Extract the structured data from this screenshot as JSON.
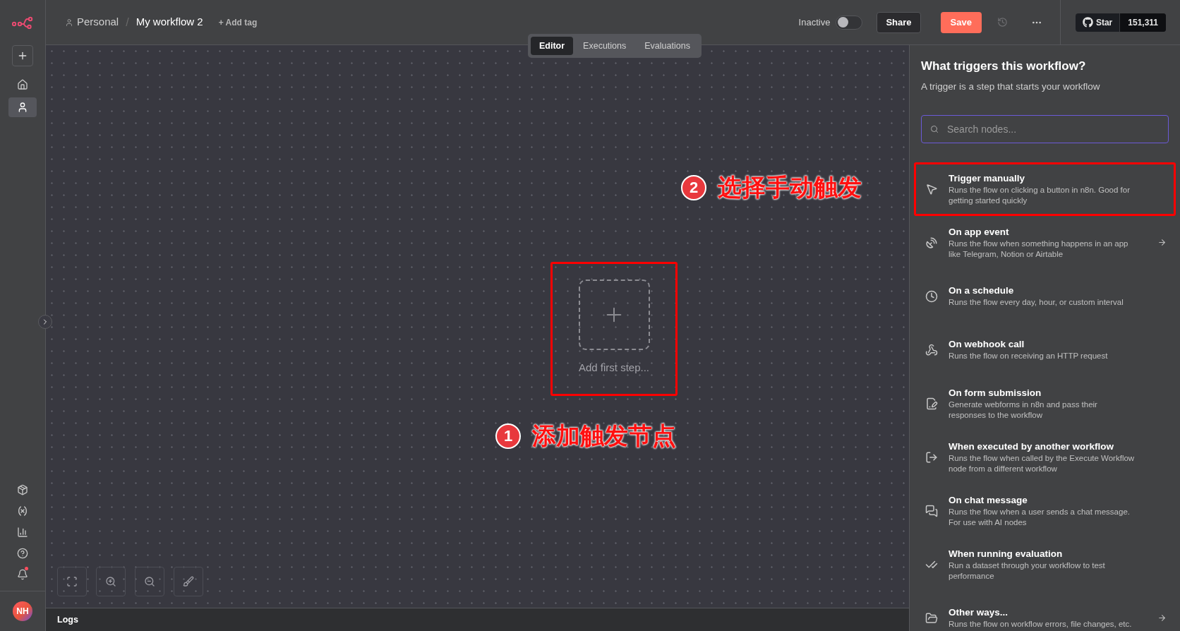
{
  "breadcrumb": {
    "project": "Personal",
    "separator": "/",
    "workflow": "My workflow 2",
    "add_tag": "+ Add tag"
  },
  "tabs": [
    {
      "label": "Editor",
      "selected": true
    },
    {
      "label": "Executions",
      "selected": false
    },
    {
      "label": "Evaluations",
      "selected": false
    }
  ],
  "header": {
    "status_label": "Inactive",
    "active": false,
    "share": "Share",
    "save": "Save",
    "github": {
      "label": "Star",
      "count": "151,311"
    }
  },
  "sidebar": {
    "items": [
      {
        "kind": "home",
        "selected": false
      },
      {
        "kind": "person",
        "selected": true
      }
    ],
    "bottom": [
      {
        "kind": "templates",
        "badge": false
      },
      {
        "kind": "variables",
        "badge": false
      },
      {
        "kind": "insights",
        "badge": false
      },
      {
        "kind": "help",
        "badge": false
      },
      {
        "kind": "notifications",
        "badge": true
      }
    ],
    "avatar": "NH"
  },
  "canvas": {
    "add_step": {
      "label": "Add first step...",
      "annotated": true
    },
    "annotations": [
      {
        "number": "1",
        "text": "添加触发节点"
      },
      {
        "number": "2",
        "text": "选择手动触发"
      }
    ],
    "logs": "Logs"
  },
  "panel": {
    "title": "What triggers this workflow?",
    "subtitle": "A trigger is a step that starts your workflow",
    "search": {
      "placeholder": "Search nodes..."
    },
    "items": [
      {
        "kind": "manual",
        "title": "Trigger manually",
        "description": "Runs the flow on clicking a button in n8n. Good for getting started quickly",
        "submenu": false,
        "annotated": true
      },
      {
        "kind": "app",
        "title": "On app event",
        "description": "Runs the flow when something happens in an app like Telegram, Notion or Airtable",
        "submenu": true,
        "annotated": false
      },
      {
        "kind": "schedule",
        "title": "On a schedule",
        "description": "Runs the flow every day, hour, or custom interval",
        "submenu": false,
        "annotated": false
      },
      {
        "kind": "webhook",
        "title": "On webhook call",
        "description": "Runs the flow on receiving an HTTP request",
        "submenu": false,
        "annotated": false
      },
      {
        "kind": "form",
        "title": "On form submission",
        "description": "Generate webforms in n8n and pass their responses to the workflow",
        "submenu": false,
        "annotated": false
      },
      {
        "kind": "subworkflow",
        "title": "When executed by another workflow",
        "description": "Runs the flow when called by the Execute Workflow node from a different workflow",
        "submenu": false,
        "annotated": false
      },
      {
        "kind": "chat",
        "title": "On chat message",
        "description": "Runs the flow when a user sends a chat message. For use with AI nodes",
        "submenu": false,
        "annotated": false
      },
      {
        "kind": "evaluation",
        "title": "When running evaluation",
        "description": "Run a dataset through your workflow to test performance",
        "submenu": false,
        "annotated": false
      },
      {
        "kind": "other",
        "title": "Other ways...",
        "description": "Runs the flow on workflow errors, file changes, etc.",
        "submenu": true,
        "annotated": false
      }
    ]
  }
}
